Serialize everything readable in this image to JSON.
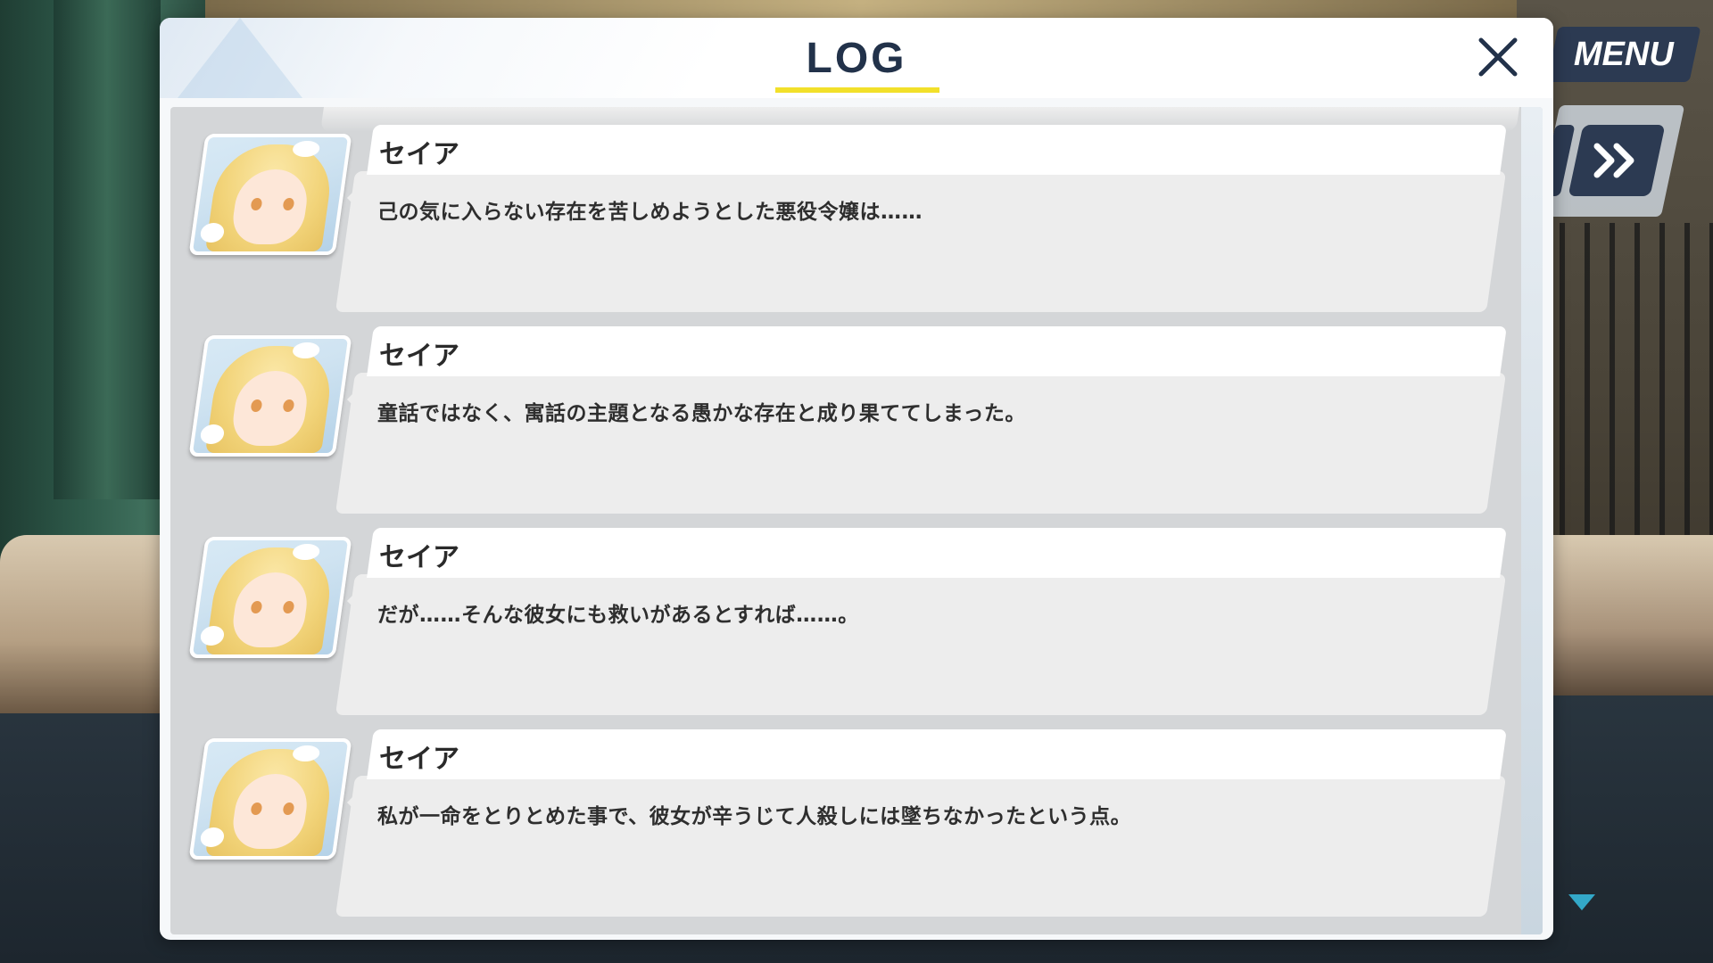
{
  "dialog": {
    "title": "LOG",
    "close_icon": "close-icon"
  },
  "hud": {
    "menu_label": "MENU",
    "fast_forward_icon": "fast-forward-icon",
    "scroll_down_icon": "chevron-down-icon"
  },
  "entries": [
    {
      "speaker": "セイア",
      "text": "己の気に入らない存在を苦しめようとした悪役令嬢は……",
      "avatar": "seia-portrait"
    },
    {
      "speaker": "セイア",
      "text": "童話ではなく、寓話の主題となる愚かな存在と成り果ててしまった。",
      "avatar": "seia-portrait"
    },
    {
      "speaker": "セイア",
      "text": "だが……そんな彼女にも救いがあるとすれば……。",
      "avatar": "seia-portrait"
    },
    {
      "speaker": "セイア",
      "text": "私が一命をとりとめた事で、彼女が辛うじて人殺しには墜ちなかったという点。",
      "avatar": "seia-portrait"
    }
  ],
  "colors": {
    "title_text": "#22324a",
    "title_underline": "#f2e02a",
    "hud_button": "#2c3a52",
    "scroll_arrow": "#33a8c8"
  }
}
